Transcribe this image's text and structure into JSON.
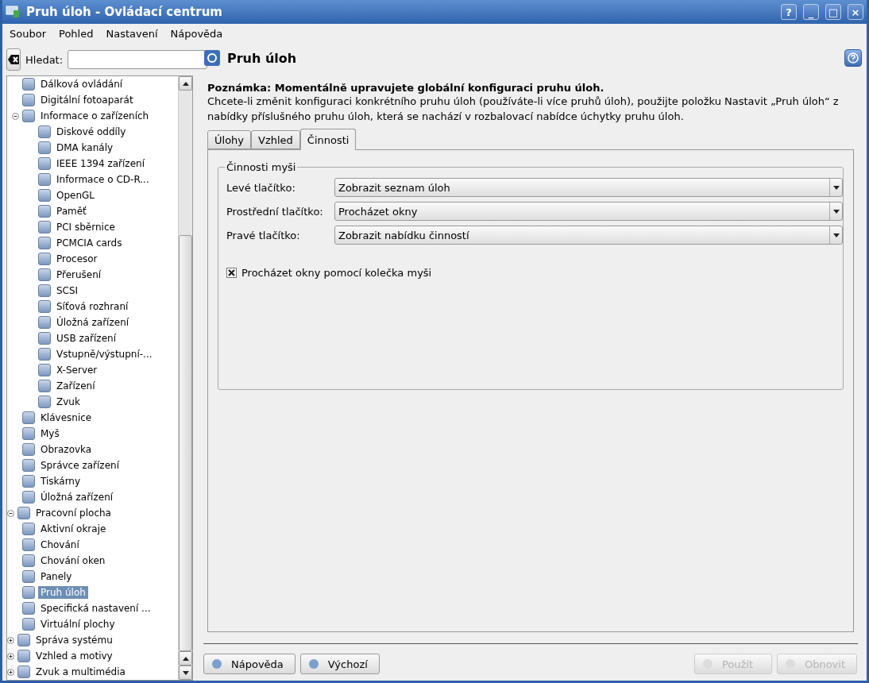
{
  "window": {
    "title": "Pruh úloh - Ovládací centrum",
    "buttons": [
      "?",
      "_",
      "□",
      "×"
    ]
  },
  "menu": [
    "Soubor",
    "Pohled",
    "Nastavení",
    "Nápověda"
  ],
  "search": {
    "label": "Hledat:"
  },
  "tree": [
    {
      "children": [
        {
          "label": "Dálková ovládání",
          "selected": false
        },
        {
          "label": "Digitální fotoaparát",
          "selected": false
        },
        {
          "label": "Informace o zařízeních",
          "selected": false,
          "expanded": true,
          "children": [
            {
              "label": "Diskové oddíly",
              "selected": false
            },
            {
              "label": "DMA kanály",
              "selected": false
            },
            {
              "label": "IEEE 1394 zařízení",
              "selected": false
            },
            {
              "label": "Informace o CD-R...",
              "selected": false
            },
            {
              "label": "OpenGL",
              "selected": false
            },
            {
              "label": "Paměť",
              "selected": false
            },
            {
              "label": "PCI sběrnice",
              "selected": false
            },
            {
              "label": "PCMCIA cards",
              "selected": false
            },
            {
              "label": "Procesor",
              "selected": false
            },
            {
              "label": "Přerušení",
              "selected": false
            },
            {
              "label": "SCSI",
              "selected": false
            },
            {
              "label": "Síťová rozhraní",
              "selected": false
            },
            {
              "label": "Úložná zařízení",
              "selected": false
            },
            {
              "label": "USB zařízení",
              "selected": false
            },
            {
              "label": "Vstupně/výstupní-...",
              "selected": false
            },
            {
              "label": "X-Server",
              "selected": false
            },
            {
              "label": "Zařízení",
              "selected": false
            },
            {
              "label": "Zvuk",
              "selected": false
            }
          ]
        },
        {
          "label": "Klávesnice",
          "selected": false
        },
        {
          "label": "Myš",
          "selected": false
        },
        {
          "label": "Obrazovka",
          "selected": false
        },
        {
          "label": "Správce zařízení",
          "selected": false
        },
        {
          "label": "Tiskárny",
          "selected": false
        },
        {
          "label": "Úložná zařízení",
          "selected": false
        }
      ]
    },
    {
      "label": "Pracovní plocha",
      "selected": false,
      "expanded": true,
      "children": [
        {
          "label": "Aktivní okraje",
          "selected": false
        },
        {
          "label": "Chování",
          "selected": false
        },
        {
          "label": "Chování oken",
          "selected": false
        },
        {
          "label": "Panely",
          "selected": false
        },
        {
          "label": "Pruh úloh",
          "selected": true
        },
        {
          "label": "Specifická nastavení ...",
          "selected": false
        },
        {
          "label": "Virtuální plochy",
          "selected": false
        }
      ]
    },
    {
      "label": "Správa systému",
      "selected": false,
      "expanded": false
    },
    {
      "label": "Vzhled a motivy",
      "selected": false,
      "expanded": false
    },
    {
      "label": "Zvuk a multimédia",
      "selected": false,
      "expanded": false
    }
  ],
  "module": {
    "title": "Pruh úloh",
    "note_title": "Poznámka: Momentálně upravujete globální konfiguraci pruhu úloh.",
    "note_text": "Chcete-li změnit konfiguraci konkrétního pruhu úloh (používáte-li více pruhů úloh), použijte položku Nastavit „Pruh úloh“ z nabídky příslušného pruhu úloh, která se nachází v rozbalovací nabídce úchytky pruhu úloh."
  },
  "tabs": [
    {
      "label": "Úlohy",
      "selected": false
    },
    {
      "label": "Vzhled",
      "selected": false
    },
    {
      "label": "Činnosti",
      "selected": true
    }
  ],
  "group": {
    "title": "Činnosti myši",
    "rows": [
      {
        "label": "Levé tlačítko:",
        "value": "Zobrazit seznam úloh"
      },
      {
        "label": "Prostřední tlačítko:",
        "value": "Procházet okny"
      },
      {
        "label": "Pravé tlačítko:",
        "value": "Zobrazit nabídku činností"
      }
    ],
    "checkbox": {
      "label": "Procházet okny pomocí kolečka myši",
      "checked": true
    }
  },
  "buttons_left": [
    {
      "label": "Nápověda",
      "disabled": false
    },
    {
      "label": "Výchozí",
      "disabled": false
    }
  ],
  "buttons_right": [
    {
      "label": "Použít",
      "disabled": true
    },
    {
      "label": "Obnovit",
      "disabled": true
    }
  ]
}
